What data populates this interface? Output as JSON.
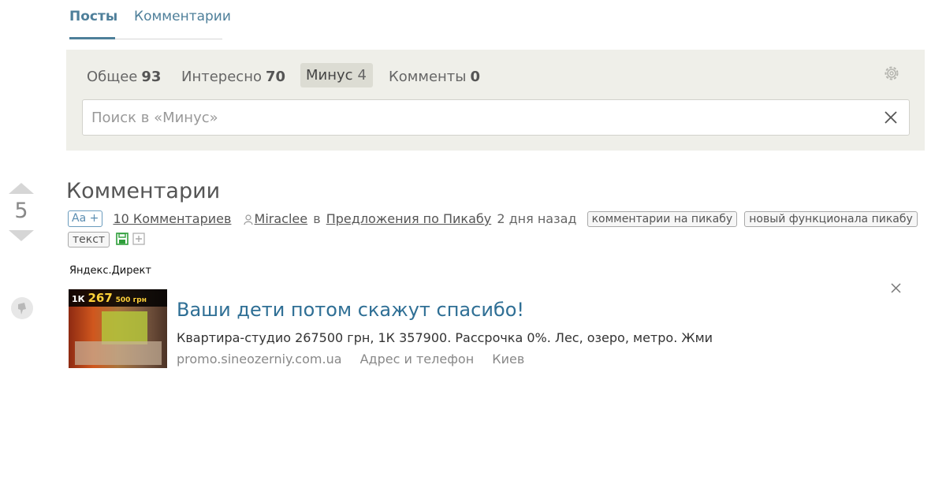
{
  "tabs": {
    "posts": "Посты",
    "comments": "Комментарии"
  },
  "filters": {
    "all": {
      "label": "Общее",
      "count": "93"
    },
    "interesting": {
      "label": "Интересно",
      "count": "70"
    },
    "minus": {
      "label": "Минус",
      "count": "4"
    },
    "comments": {
      "label": "Комменты",
      "count": "0"
    }
  },
  "search": {
    "placeholder": "Поиск в «Минус»",
    "value": ""
  },
  "icons": {
    "settings": "gear-icon",
    "clear_search": "close-icon",
    "vote_up": "arrow-up-icon",
    "vote_down": "arrow-down-icon",
    "pin": "pin-icon",
    "author": "user-icon",
    "save": "save-icon",
    "expand": "plus-icon",
    "ad_close": "close-icon"
  },
  "post": {
    "rating": "5",
    "title": "Комментарии",
    "font_button": "Aa +",
    "comments_count": "10 Комментариев",
    "author": "Miraclee",
    "in_word": "в",
    "community": "Предложения по Пикабу",
    "time": "2 дня назад",
    "tags": [
      "комментарии на пикабу",
      "новый функционала пикабу",
      "текст"
    ]
  },
  "ad": {
    "label": "Яндекс.Директ",
    "image_price_prefix": "1К",
    "image_price_value": "267",
    "image_price_suffix": "500 грн",
    "title": "Ваши дети потом скажут спасибо!",
    "text": "Квартира-студио 267500 грн, 1К 357900. Рассрочка 0%. Лес, озеро, метро. Жми",
    "domain": "promo.sineozerniy.com.ua",
    "contacts": "Адрес и телефон",
    "city": "Киев"
  },
  "colors": {
    "accent": "#4e7f9a",
    "panel_bg": "#efefe9",
    "ad_title": "#2f6f95",
    "save_icon": "#2e9e3a"
  }
}
